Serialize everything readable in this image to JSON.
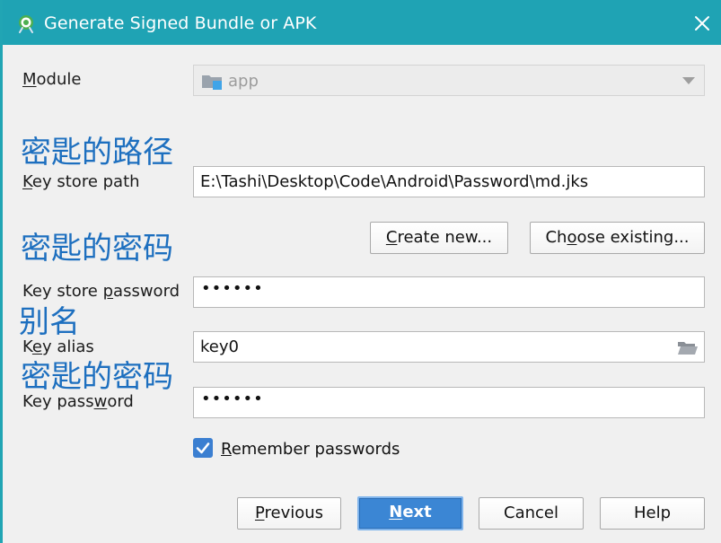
{
  "window": {
    "title": "Generate Signed Bundle or APK",
    "accent_color": "#1fa3b4",
    "app_icon": "android-studio-icon",
    "close_icon": "close-icon"
  },
  "module": {
    "label_first": "M",
    "label_rest": "odule",
    "value": "app",
    "icon": "module-folder-icon"
  },
  "annotations": {
    "key_store_path": "密匙的路径",
    "key_store_password": "密匙的密码",
    "alias": "别名",
    "key_password": "密匙的密码",
    "color": "#1d6fbf"
  },
  "key_store_path": {
    "label_u": "K",
    "label_rest": "ey store path",
    "value": "E:\\Tashi\\Desktop\\Code\\Android\\Password\\md.jks"
  },
  "buttons": {
    "create_new_u": "C",
    "create_new_rest": "reate new...",
    "choose_existing_pre": "Ch",
    "choose_existing_u": "o",
    "choose_existing_rest": "ose existing...",
    "previous_u": "P",
    "previous_rest": "revious",
    "next_u": "N",
    "next_rest": "ext",
    "cancel": "Cancel",
    "help": "Help"
  },
  "key_store_password": {
    "label_pre": "Key store ",
    "label_u": "p",
    "label_rest": "assword",
    "value": "••••••"
  },
  "key_alias": {
    "label_pre": "K",
    "label_u": "e",
    "label_rest": "y alias",
    "value": "key0",
    "icon": "folder-open-icon"
  },
  "key_password": {
    "label_pre": "Key pass",
    "label_u": "w",
    "label_rest": "ord",
    "value": "••••••"
  },
  "remember": {
    "label_u": "R",
    "label_rest": "emember passwords",
    "checked": true,
    "icon": "checkmark-icon"
  }
}
